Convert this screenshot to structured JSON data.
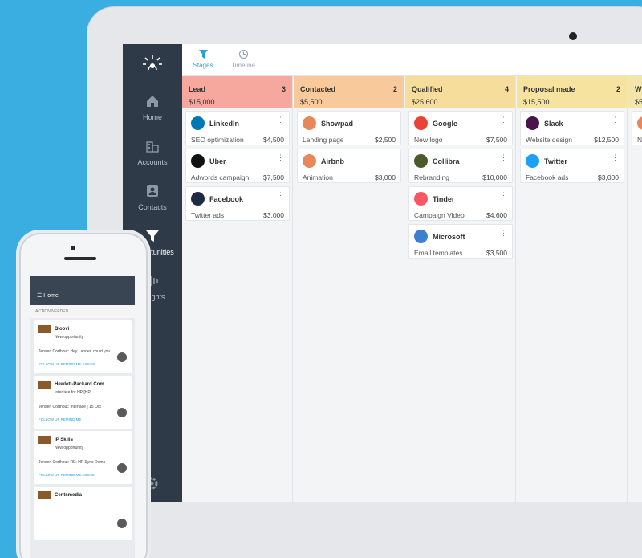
{
  "sidebar": {
    "items": [
      {
        "label": "Home",
        "icon": "home-icon"
      },
      {
        "label": "Accounts",
        "icon": "accounts-icon"
      },
      {
        "label": "Contacts",
        "icon": "contacts-icon"
      },
      {
        "label": "Opportunities",
        "icon": "funnel-icon",
        "active": true
      },
      {
        "label": "Insights",
        "icon": "insights-icon"
      }
    ]
  },
  "tabs": [
    {
      "label": "Stages",
      "icon": "funnel-icon",
      "active": true
    },
    {
      "label": "Timeline",
      "icon": "clock-icon"
    }
  ],
  "columns": [
    {
      "name": "Lead",
      "count": "3",
      "amount": "$15,000",
      "color": "#f6a89e",
      "cards": [
        {
          "company": "LinkedIn",
          "desc": "SEO optimization",
          "amount": "$4,500",
          "logo_color": "#0077b5"
        },
        {
          "company": "Uber",
          "desc": "Adwords campaign",
          "amount": "$7,500",
          "logo_color": "#111111"
        },
        {
          "company": "Facebook",
          "desc": "Twitter ads",
          "amount": "$3,000",
          "logo_color": "#1d2a44"
        }
      ]
    },
    {
      "name": "Contacted",
      "count": "2",
      "amount": "$5,500",
      "color": "#f8c99a",
      "cards": [
        {
          "company": "Showpad",
          "desc": "Landing page",
          "amount": "$2,500",
          "logo_color": "#e8875a"
        },
        {
          "company": "Airbnb",
          "desc": "Animation",
          "amount": "$3,000",
          "logo_color": "#e8875a"
        }
      ]
    },
    {
      "name": "Qualified",
      "count": "4",
      "amount": "$25,600",
      "color": "#f7dd9c",
      "cards": [
        {
          "company": "Google",
          "desc": "New logo",
          "amount": "$7,500",
          "logo_color": "#ea4335"
        },
        {
          "company": "Collibra",
          "desc": "Rebranding",
          "amount": "$10,000",
          "logo_color": "#4a5a2a"
        },
        {
          "company": "Tinder",
          "desc": "Campaign Video",
          "amount": "$4,600",
          "logo_color": "#fd5564"
        },
        {
          "company": "Microsoft",
          "desc": "Email templates",
          "amount": "$3,500",
          "logo_color": "#3a7fd0"
        }
      ]
    },
    {
      "name": "Proposal made",
      "count": "2",
      "amount": "$15,500",
      "color": "#f7e3a0",
      "cards": [
        {
          "company": "Slack",
          "desc": "Website design",
          "amount": "$12,500",
          "logo_color": "#4a154b"
        },
        {
          "company": "Twitter",
          "desc": "Facebook ads",
          "amount": "$3,000",
          "logo_color": "#1da1f2"
        }
      ]
    },
    {
      "name": "W",
      "count": "",
      "amount": "$5",
      "color": "#f3e6a8",
      "cards": [
        {
          "company": "",
          "desc": "Ne",
          "amount": "",
          "logo_color": "#e8875a"
        }
      ]
    }
  ],
  "phone": {
    "header": "Home",
    "section": "ACTION NEEDED",
    "cards": [
      {
        "title": "Bloovi",
        "sub": "New opportunity",
        "meta": "Jensen Corthout: Hey Lander, could you...",
        "actions": "FOLLOW UP     REMIND ME     ASSIGN"
      },
      {
        "title": "Hewlett-Packard Com...",
        "sub": "Interface for HP [HP]",
        "meta": "Jensen Corthout: Interface | 15 Oct",
        "actions": "FOLLOW UP     REMIND ME"
      },
      {
        "title": "IP Skills",
        "sub": "New opportunity",
        "meta": "Jensen Corthout: RE: HP Sync Demo",
        "actions": "FOLLOW UP     REMIND ME     ASSIGN"
      },
      {
        "title": "Centsmedia",
        "sub": "",
        "meta": "",
        "actions": ""
      }
    ]
  }
}
